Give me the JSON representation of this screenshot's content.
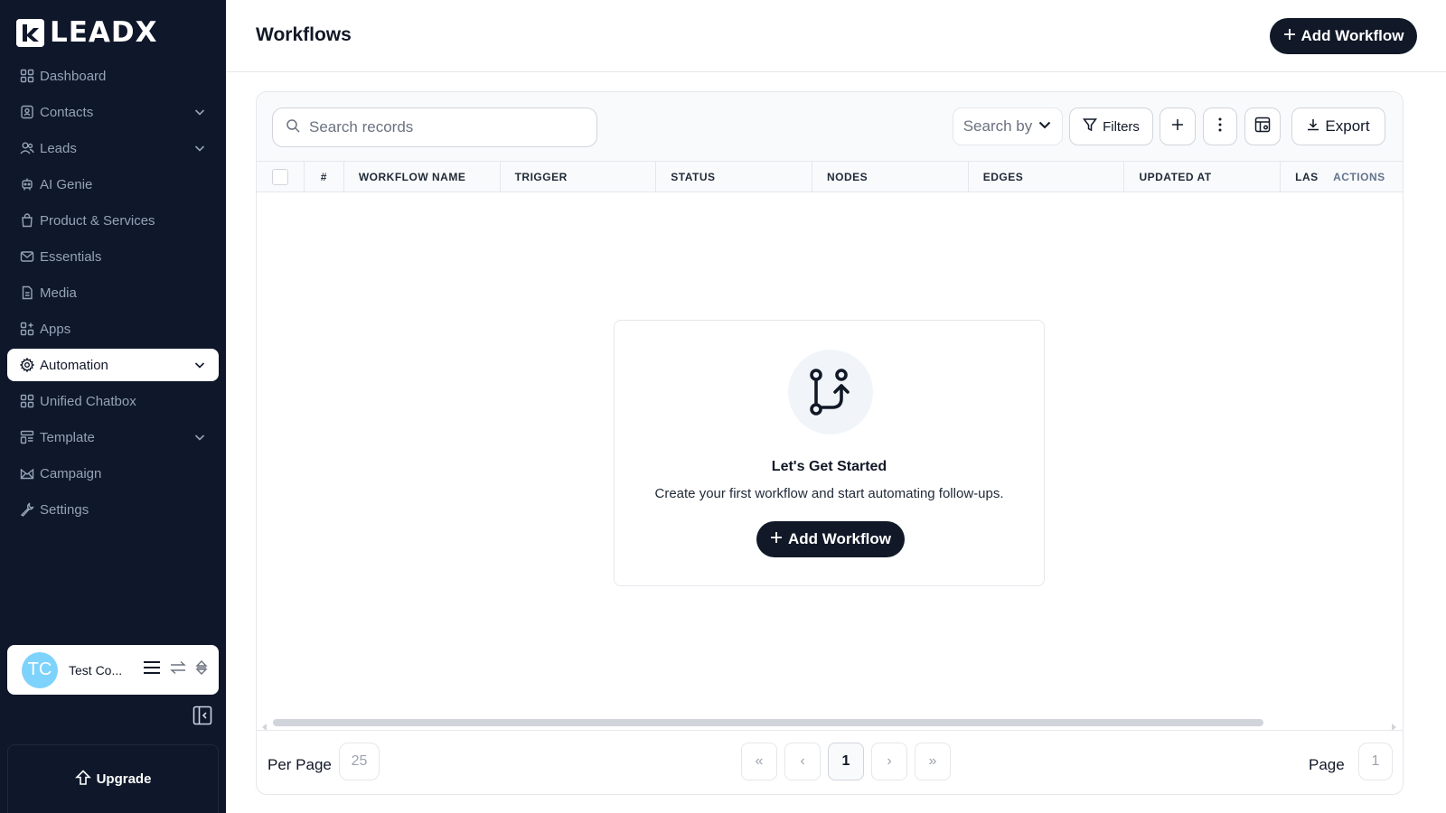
{
  "app": {
    "logo_text": "LEADX"
  },
  "sidebar": {
    "items": [
      {
        "label": "Dashboard",
        "icon": "grid-icon",
        "expandable": false
      },
      {
        "label": "Contacts",
        "icon": "contact-card-icon",
        "expandable": true
      },
      {
        "label": "Leads",
        "icon": "users-icon",
        "expandable": true
      },
      {
        "label": "AI Genie",
        "icon": "robot-icon",
        "expandable": false
      },
      {
        "label": "Product & Services",
        "icon": "shopping-bag-icon",
        "expandable": false
      },
      {
        "label": "Essentials",
        "icon": "mail-icon",
        "expandable": false
      },
      {
        "label": "Media",
        "icon": "file-icon",
        "expandable": false
      },
      {
        "label": "Apps",
        "icon": "apps-icon",
        "expandable": false
      },
      {
        "label": "Automation",
        "icon": "gear-icon",
        "expandable": true,
        "active": true
      },
      {
        "label": "Unified Chatbox",
        "icon": "grid-icon",
        "expandable": false
      },
      {
        "label": "Template",
        "icon": "template-icon",
        "expandable": true
      },
      {
        "label": "Campaign",
        "icon": "envelope-open-icon",
        "expandable": false
      },
      {
        "label": "Settings",
        "icon": "wrench-icon",
        "expandable": false
      }
    ],
    "user": {
      "initials": "TC",
      "name": "Test Co..."
    },
    "upgrade_label": "Upgrade"
  },
  "header": {
    "title": "Workflows",
    "add_button_label": "Add Workflow"
  },
  "toolbar": {
    "search_placeholder": "Search records",
    "search_by_label": "Search by",
    "filters_label": "Filters",
    "export_label": "Export"
  },
  "table": {
    "columns": [
      "#",
      "WORKFLOW NAME",
      "TRIGGER",
      "STATUS",
      "NODES",
      "EDGES",
      "UPDATED AT",
      "LAST",
      "ACTIONS"
    ]
  },
  "empty_state": {
    "title": "Let's Get Started",
    "description": "Create your first workflow and start automating follow-ups.",
    "button_label": "Add Workflow"
  },
  "pagination": {
    "per_page_label": "Per Page",
    "per_page_value": "25",
    "current_page": "1",
    "page_label": "Page",
    "page_value": "1",
    "first_symbol": "«",
    "prev_symbol": "‹",
    "next_symbol": "›",
    "last_symbol": "»"
  },
  "colors": {
    "sidebar_bg": "#0f172a",
    "primary_dark": "#111827",
    "avatar": "#7dd3fc"
  }
}
